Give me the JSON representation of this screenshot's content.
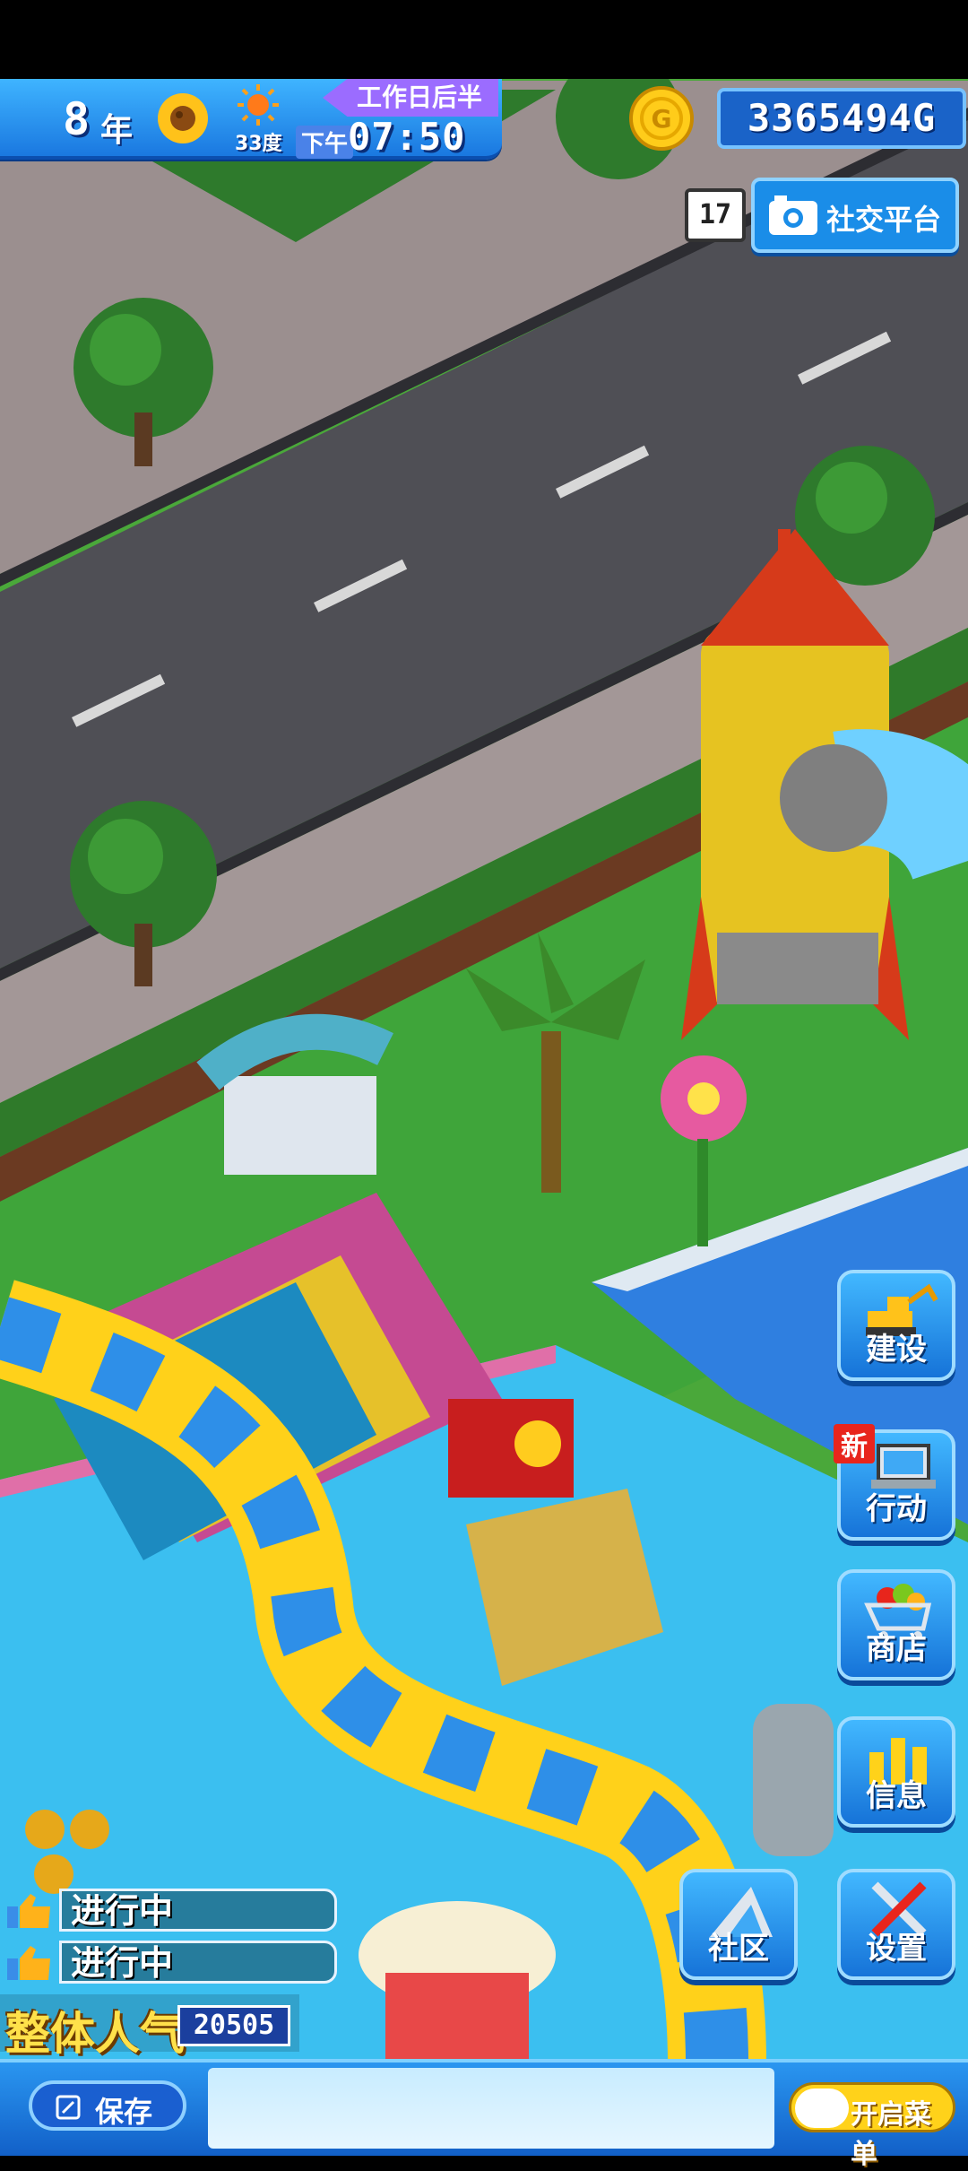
{
  "hud": {
    "year_number": "8",
    "year_unit": "年",
    "temperature": "33度",
    "period": "工作日后半",
    "ampm": "下午",
    "time": "07:50",
    "money": "3365494G"
  },
  "social": {
    "count": "17",
    "label": "社交平台"
  },
  "side_menu": {
    "build": "建设",
    "action": "行动",
    "action_new_tag": "新",
    "shop": "商店",
    "info": "信息",
    "community": "社区",
    "settings": "设置"
  },
  "progress": [
    {
      "label": "进行中"
    },
    {
      "label": "进行中"
    }
  ],
  "popularity": {
    "label": "整体人气",
    "value": "20505"
  },
  "bottom": {
    "save_label": "保存",
    "menu_label": "开启菜单"
  },
  "icons": [
    "sunflower-icon",
    "sun-icon",
    "coin-icon",
    "camera-icon",
    "excavator-icon",
    "laptop-icon",
    "shopping-cart-icon",
    "chart-icon",
    "community-icon",
    "tools-icon",
    "thumbs-up-icon",
    "save-icon"
  ]
}
